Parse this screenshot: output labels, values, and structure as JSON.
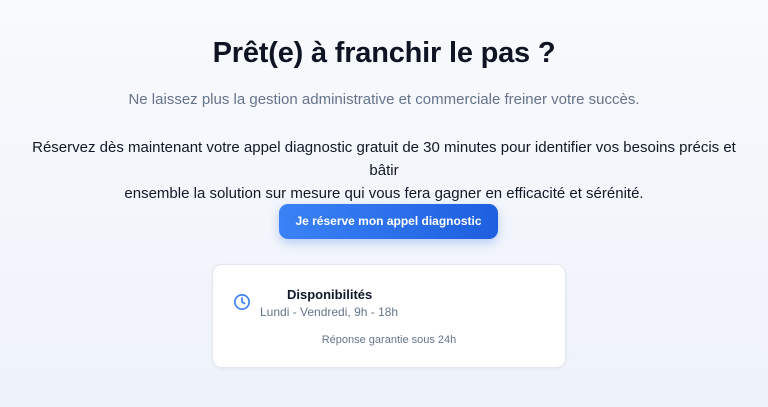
{
  "hero": {
    "title": "Prêt(e) à franchir le pas ?",
    "subtitle": "Ne laissez plus la gestion administrative et commerciale freiner votre succès.",
    "body_line1": "Réservez dès maintenant votre appel diagnostic gratuit de 30 minutes pour identifier vos besoins précis et bâtir",
    "body_line2": "ensemble la solution sur mesure qui vous fera gagner en efficacité et sérénité."
  },
  "cta": {
    "label": "Je réserve mon appel diagnostic"
  },
  "availability": {
    "icon": "clock-icon",
    "title": "Disponibilités",
    "hours": "Lundi - Vendredi, 9h - 18h",
    "guarantee": "Réponse garantie sous 24h"
  },
  "colors": {
    "accent": "#2563eb",
    "title": "#0f1424",
    "muted": "#64748b"
  }
}
